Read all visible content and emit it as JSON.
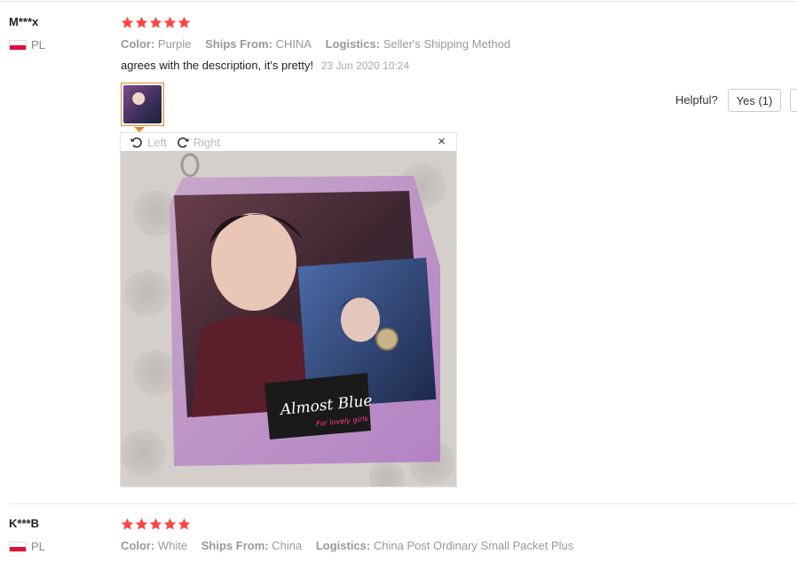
{
  "reviews": [
    {
      "user": "M***x",
      "country": "PL",
      "stars": 5,
      "color_label": "Color:",
      "color_value": "Purple",
      "ships_label": "Ships From:",
      "ships_value": "CHINA",
      "logistics_label": "Logistics:",
      "logistics_value": "Seller's Shipping Method",
      "text": "agrees with the description, it's pretty!",
      "date": "23 Jun 2020 10:24",
      "helpful_label": "Helpful?",
      "yes_label": "Yes (1)"
    },
    {
      "user": "K***B",
      "country": "PL",
      "stars": 5,
      "color_label": "Color:",
      "color_value": "White",
      "ships_label": "Ships From:",
      "ships_value": "China",
      "logistics_label": "Logistics:",
      "logistics_value": "China Post Ordinary Small Packet Plus"
    }
  ],
  "viewer": {
    "rotate_left": "Left",
    "rotate_right": "Right",
    "close": "×",
    "brand_text": "Almost Blue",
    "brand_sub": "For lovely girls"
  },
  "colors": {
    "star": "#ff4747",
    "thumb_border": "#e08a2a"
  },
  "icons": {
    "star": "star-icon",
    "rotate_left": "rotate-left-icon",
    "rotate_right": "rotate-right-icon",
    "close": "close-icon",
    "flag": "poland-flag-icon"
  }
}
